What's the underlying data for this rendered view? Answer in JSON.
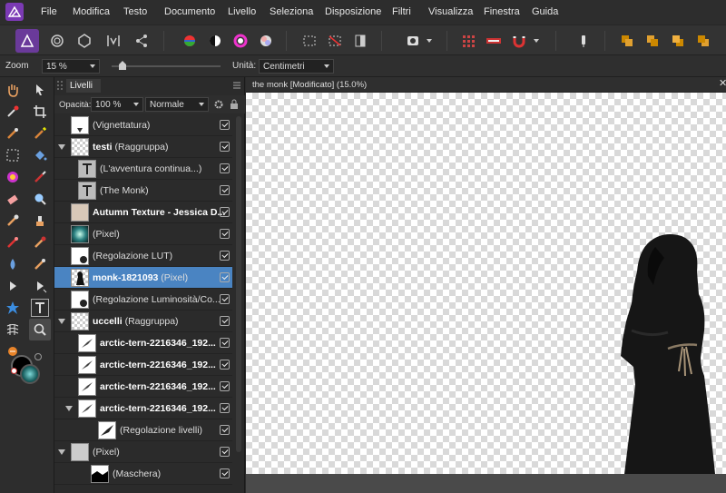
{
  "menu": [
    "File",
    "Modifica",
    "Testo",
    "Documento",
    "Livello",
    "Seleziona",
    "Disposizione",
    "Filtri",
    "Visualizza",
    "Finestra",
    "Guida"
  ],
  "context_bar": {
    "zoom_label": "Zoom",
    "zoom_value": "15 %",
    "units_label": "Unità:",
    "units_value": "Centimetri"
  },
  "layers_panel": {
    "tab_label": "Livelli",
    "opacity_label": "Opacità:",
    "opacity_value": "100 %",
    "blend_mode": "Normale",
    "layers": [
      {
        "bold": "",
        "rest": "(Vignettatura)"
      },
      {
        "bold": "testi",
        "rest": " (Raggruppa)"
      },
      {
        "bold": "",
        "rest": "(L'avventura continua...)"
      },
      {
        "bold": "",
        "rest": "(The Monk)"
      },
      {
        "bold": "Autumn Texture - Jessica D...",
        "rest": ""
      },
      {
        "bold": "",
        "rest": "(Pixel)"
      },
      {
        "bold": "",
        "rest": "(Regolazione LUT)"
      },
      {
        "bold": "monk-1821093",
        "rest": " (Pixel)"
      },
      {
        "bold": "",
        "rest": "(Regolazione Luminosità/Co..."
      },
      {
        "bold": "uccelli",
        "rest": " (Raggruppa)"
      },
      {
        "bold": "arctic-tern-2216346_192...",
        "rest": ""
      },
      {
        "bold": "arctic-tern-2216346_192...",
        "rest": ""
      },
      {
        "bold": "arctic-tern-2216346_192...",
        "rest": ""
      },
      {
        "bold": "arctic-tern-2216346_192...",
        "rest": ""
      },
      {
        "bold": "",
        "rest": "(Regolazione livelli)"
      },
      {
        "bold": "",
        "rest": "(Pixel)"
      },
      {
        "bold": "",
        "rest": "(Maschera)"
      }
    ]
  },
  "document": {
    "tab_title": "the monk [Modificato] (15.0%)"
  },
  "colors": {
    "selection": "#4a84c2",
    "app_accent": "#7b3ab4",
    "panel_bg": "#2b2b2b"
  }
}
